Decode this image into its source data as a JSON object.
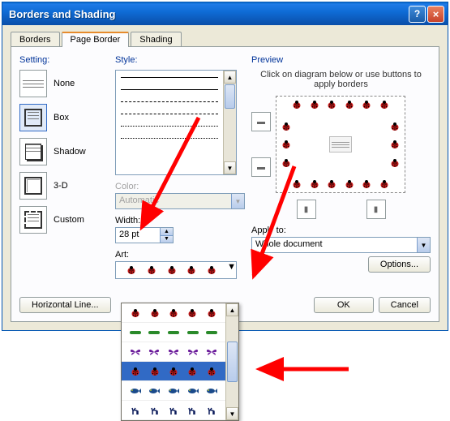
{
  "title": "Borders and Shading",
  "tabs": [
    "Borders",
    "Page Border",
    "Shading"
  ],
  "active_tab": 1,
  "setting": {
    "label": "Setting:",
    "options": [
      "None",
      "Box",
      "Shadow",
      "3-D",
      "Custom"
    ]
  },
  "style_label": "Style:",
  "color": {
    "label": "Color:",
    "value": "Automatic",
    "enabled": false
  },
  "width": {
    "label": "Width:",
    "value": "28 pt"
  },
  "art_label": "Art:",
  "preview": {
    "label": "Preview",
    "help": "Click on diagram below or use buttons to apply borders"
  },
  "apply_to": {
    "label": "Apply to:",
    "value": "Whole document"
  },
  "buttons": {
    "options": "Options...",
    "horizontal_line": "Horizontal Line...",
    "ok": "OK",
    "cancel": "Cancel"
  },
  "art_dropdown": {
    "options": [
      "ladybug-red",
      "bone-green",
      "butterfly-purple",
      "ladybug-red",
      "fish-blue",
      "deer-navy"
    ],
    "selected_index": 3
  },
  "colors": {
    "titlebar": "#0f6cd6",
    "accent": "#e68b2c",
    "arrow": "#ff0000"
  }
}
